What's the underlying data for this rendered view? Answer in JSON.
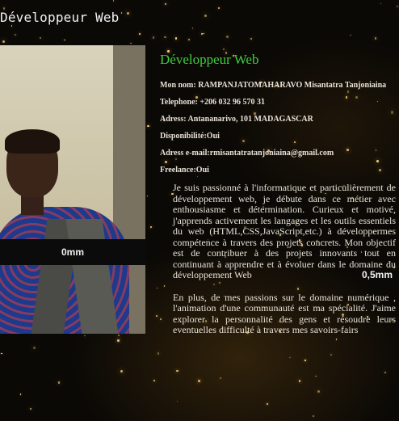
{
  "header": {
    "title": "Développeur Web"
  },
  "photo": {
    "label": "0mm"
  },
  "side": {
    "label": "0,5mm"
  },
  "profile": {
    "heading": "Développeur Web",
    "name": "Mon nom: RAMPANJATOMAHARAVO Misantatra Tanjoniaina",
    "phone": "Telephone: +206 032 96 570 31",
    "address": "Adress: Antananarivo, 101 MADAGASCAR",
    "availability": "Disponibilité:Oui",
    "email": "Adress e-mail:rmisantatratanjoniaina@gmail.com",
    "freelance": "Freelance:Oui"
  },
  "bio": {
    "paragraph1": "Je suis passionné à l'informatique et particulièrement de développement web, je débute dans ce métier avec enthousiasme et détermination. Curieux et motivé, j'apprends activement les langages et les outils essentiels du web (HTML,CSS,JavaScript,etc.) à développermes compétence à travers des projets concrets. Mon objectif est de contribuer à des projets innovants tout en continuant à apprendre et à évoluer dans le domaine du développement Web",
    "paragraph2": "En plus, de mes passions sur le domaine numérique , l'animation d'une communauté est ma spécialité. J'aime explorer la personnalité des gens et résoudre leurs eventuelles difficulté à travers mes savoirs-fairs"
  }
}
